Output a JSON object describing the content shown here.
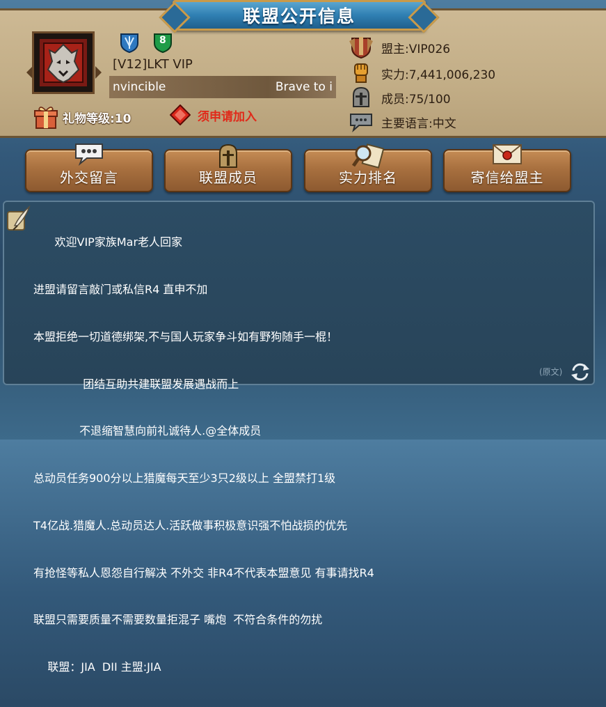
{
  "title": "联盟公开信息",
  "alliance": {
    "name": "[V12]LKT VIP",
    "motto_left": "nvincible",
    "motto_right": "Brave to i",
    "shield_level": "8",
    "gift_label": "礼物等级:10",
    "apply_label": "须申请加入"
  },
  "info": {
    "leader": "盟主:VIP026",
    "power": "实力:7,441,006,230",
    "members": "成员:75/100",
    "language": "主要语言:中文"
  },
  "buttons": [
    {
      "label": "外交留言",
      "icon": "chat-bubble-icon"
    },
    {
      "label": "联盟成员",
      "icon": "helmet-icon"
    },
    {
      "label": "实力排名",
      "icon": "magnifier-scroll-icon"
    },
    {
      "label": "寄信给盟主",
      "icon": "letter-icon"
    }
  ],
  "notice": {
    "lines": [
      "      欢迎VIP家族Mar老人回家",
      "进盟请留言敲门或私信R4 直申不加",
      "本盟拒绝一切道德绑架,不与国人玩家争斗如有野狗随手一棍！",
      "              团结互助共建联盟发展遇战而上",
      "             不退缩智慧向前礼诚待人.@全体成员",
      "总动员任务900分以上猎魔每天至少3只2级以上 全盟禁打1级",
      "T4亿战.猎魔人.总动员达人.活跃做事积极意识强不怕战损的优先",
      "有抢怪等私人恩怨自行解决 不外交 非R4不代表本盟意见 有事请找R4",
      "联盟只需要质量不需要数量拒混子 嘴炮  不符合条件的勿扰",
      "    联盟：JIA  DII 主盟:JIA"
    ],
    "original_label": "(原文)"
  },
  "colors": {
    "apply_red": "#e02a1a",
    "title_blue": "#2f7fb2",
    "panel_tan": "#c2ad86"
  }
}
